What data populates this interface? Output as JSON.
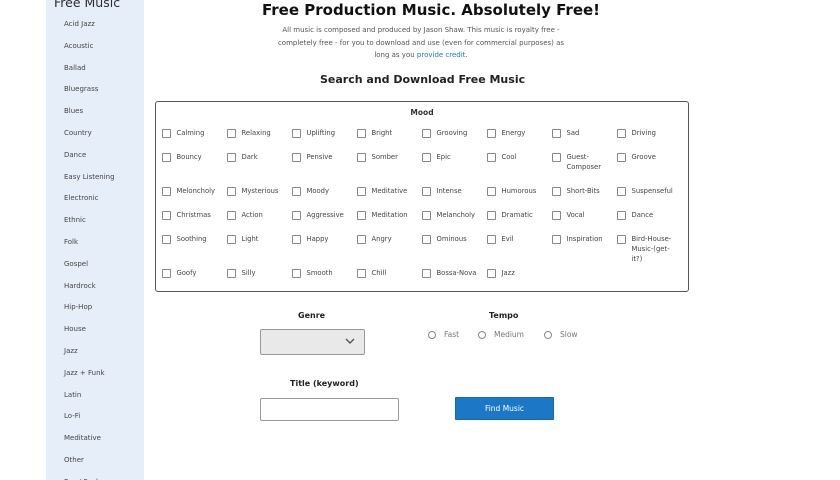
{
  "sidebar": {
    "title": "Free Music",
    "items": [
      "Acid Jazz",
      "Acoustic",
      "Ballad",
      "Bluegrass",
      "Blues",
      "Country",
      "Dance",
      "Easy Listening",
      "Electronic",
      "Ethnic",
      "Folk",
      "Gospel",
      "Hardrock",
      "Hip-Hop",
      "House",
      "Jazz",
      "Jazz + Funk",
      "Latin",
      "Lo-Fi",
      "Meditative",
      "Other",
      "Pop / Funk"
    ]
  },
  "header": {
    "title": "Free Production Music. Absolutely Free!",
    "intro": "All music is composed and produced by Jason Shaw. This music is royalty free - completely free - for you to download and use (even for commercial purposes) as long as you",
    "intro_link": "provide credit",
    "intro_end": "."
  },
  "search": {
    "title": "Search and Download Free Music",
    "mood_label": "Mood",
    "moods": [
      [
        "Calming",
        "Relaxing",
        "Uplifting",
        "Bright",
        "Grooving",
        "Energy",
        "Sad",
        "Driving"
      ],
      [
        "Bouncy",
        "Dark",
        "Pensive",
        "Somber",
        "Epic",
        "Cool",
        "Guest-Composer",
        "Groove"
      ],
      [
        "Meloncholy",
        "Mysterious",
        "Moody",
        "Meditative",
        "Intense",
        "Humorous",
        "Short-Bits",
        "Suspenseful"
      ],
      [
        "Christmas",
        "Action",
        "Aggressive",
        "Meditation",
        "Melancholy",
        "Dramatic",
        "Vocal",
        "Dance"
      ],
      [
        "Soothing",
        "Light",
        "Happy",
        "Angry",
        "Ominous",
        "Evil",
        "Inspiration",
        "Bird-House-Music-(get-it?)"
      ],
      [
        "Goofy",
        "Silly",
        "Smooth",
        "Chill",
        "Bossa-Nova",
        "Jazz"
      ]
    ],
    "genre_label": "Genre",
    "genre_value": "",
    "tempo_label": "Tempo",
    "tempo_options": [
      "Fast",
      "Medium",
      "Slow"
    ],
    "keyword_label": "Title (keyword)",
    "keyword_value": "",
    "find_button": "Find Music"
  }
}
